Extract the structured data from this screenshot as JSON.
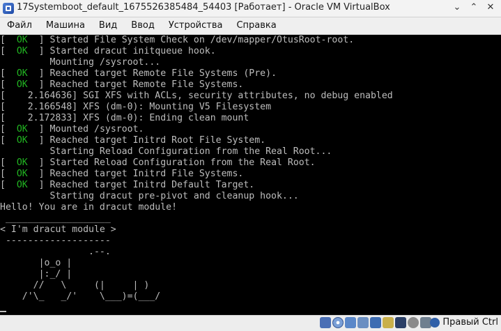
{
  "window": {
    "title": "17Systemboot_default_1675526385484_54403 [Работает] - Oracle VM VirtualBox",
    "minimize": "⌄",
    "restore": "⌃",
    "close": "✕"
  },
  "menu": [
    "Файл",
    "Машина",
    "Вид",
    "Ввод",
    "Устройства",
    "Справка"
  ],
  "console": {
    "lines": [
      {
        "ok": true,
        "text": "Started File System Check on /dev/mapper/OtusRoot-root."
      },
      {
        "ok": true,
        "text": "Started dracut initqueue hook."
      },
      {
        "ok": false,
        "text": "         Mounting /sysroot..."
      },
      {
        "ok": true,
        "text": "Reached target Remote File Systems (Pre)."
      },
      {
        "ok": true,
        "text": "Reached target Remote File Systems."
      },
      {
        "ok": false,
        "text": "[    2.164636] SGI XFS with ACLs, security attributes, no debug enabled"
      },
      {
        "ok": false,
        "text": "[    2.166548] XFS (dm-0): Mounting V5 Filesystem"
      },
      {
        "ok": false,
        "text": "[    2.172833] XFS (dm-0): Ending clean mount"
      },
      {
        "ok": true,
        "text": "Mounted /sysroot."
      },
      {
        "ok": true,
        "text": "Reached target Initrd Root File System."
      },
      {
        "ok": false,
        "text": "         Starting Reload Configuration from the Real Root..."
      },
      {
        "ok": true,
        "text": "Started Reload Configuration from the Real Root."
      },
      {
        "ok": true,
        "text": "Reached target Initrd File Systems."
      },
      {
        "ok": true,
        "text": "Reached target Initrd Default Target."
      },
      {
        "ok": false,
        "text": "         Starting dracut pre-pivot and cleanup hook..."
      },
      {
        "ok": false,
        "text": "Hello! You are in dracut module!"
      },
      {
        "ok": false,
        "text": " ___________________"
      },
      {
        "ok": false,
        "text": "< I'm dracut module >"
      },
      {
        "ok": false,
        "text": " -------------------"
      },
      {
        "ok": false,
        "text": "                .--."
      },
      {
        "ok": false,
        "text": "       |o_o |"
      },
      {
        "ok": false,
        "text": "       |:_/ |"
      },
      {
        "ok": false,
        "text": "      //   \\     (|     | )"
      },
      {
        "ok": false,
        "text": "    /'\\_   _/'    \\___)=(___/"
      }
    ],
    "ok_label": "OK"
  },
  "statusbar": {
    "icons": [
      "hard-disk-icon",
      "optical-drive-icon",
      "audio-icon",
      "network-icon",
      "usb-icon",
      "shared-folders-icon",
      "display-icon",
      "recording-icon",
      "cpu-icon"
    ],
    "host_key": "Правый Ctrl"
  }
}
